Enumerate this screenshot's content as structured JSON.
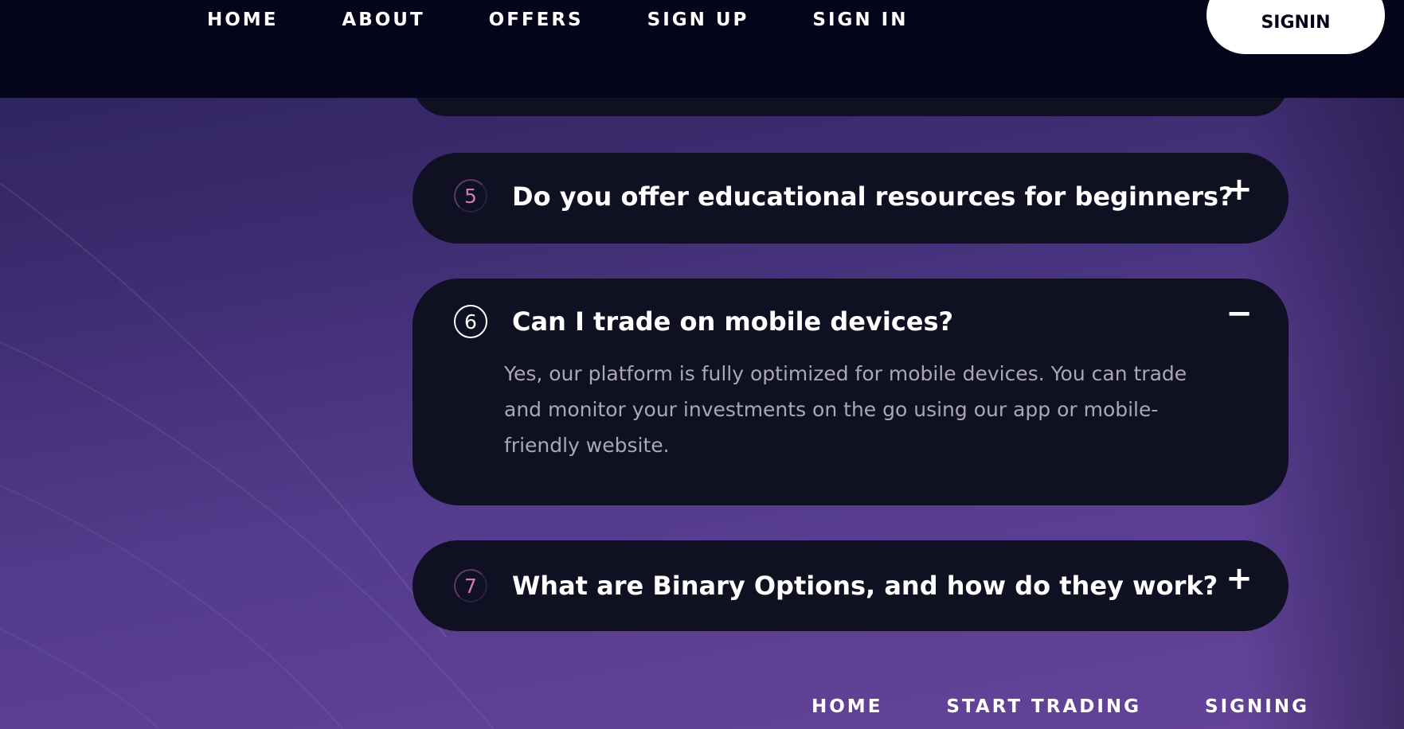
{
  "header": {
    "nav": [
      "HOME",
      "ABOUT",
      "OFFERS",
      "SIGN UP",
      "SIGN IN"
    ],
    "signin_button": "SIGNIN"
  },
  "faq": [
    {
      "number": "5",
      "question": "Do you offer educational resources for beginners?",
      "toggle": "+",
      "expanded": false
    },
    {
      "number": "6",
      "question": "Can I trade on mobile devices?",
      "toggle": "−",
      "expanded": true,
      "answer": "Yes, our platform is fully optimized for mobile devices. You can trade and monitor your investments on the go using our app or mobile-friendly website."
    },
    {
      "number": "7",
      "question": "What are Binary Options, and how do they work?",
      "toggle": "+",
      "expanded": false
    }
  ],
  "footer": {
    "nav": [
      "HOME",
      "START TRADING",
      "SIGNING"
    ]
  },
  "colors": {
    "header_bg": "#04051a",
    "card_bg": "#0f1022",
    "number_accent": "#d07ab2",
    "answer_text": "#a9a7b8",
    "bg_purple": "#543b8c"
  }
}
